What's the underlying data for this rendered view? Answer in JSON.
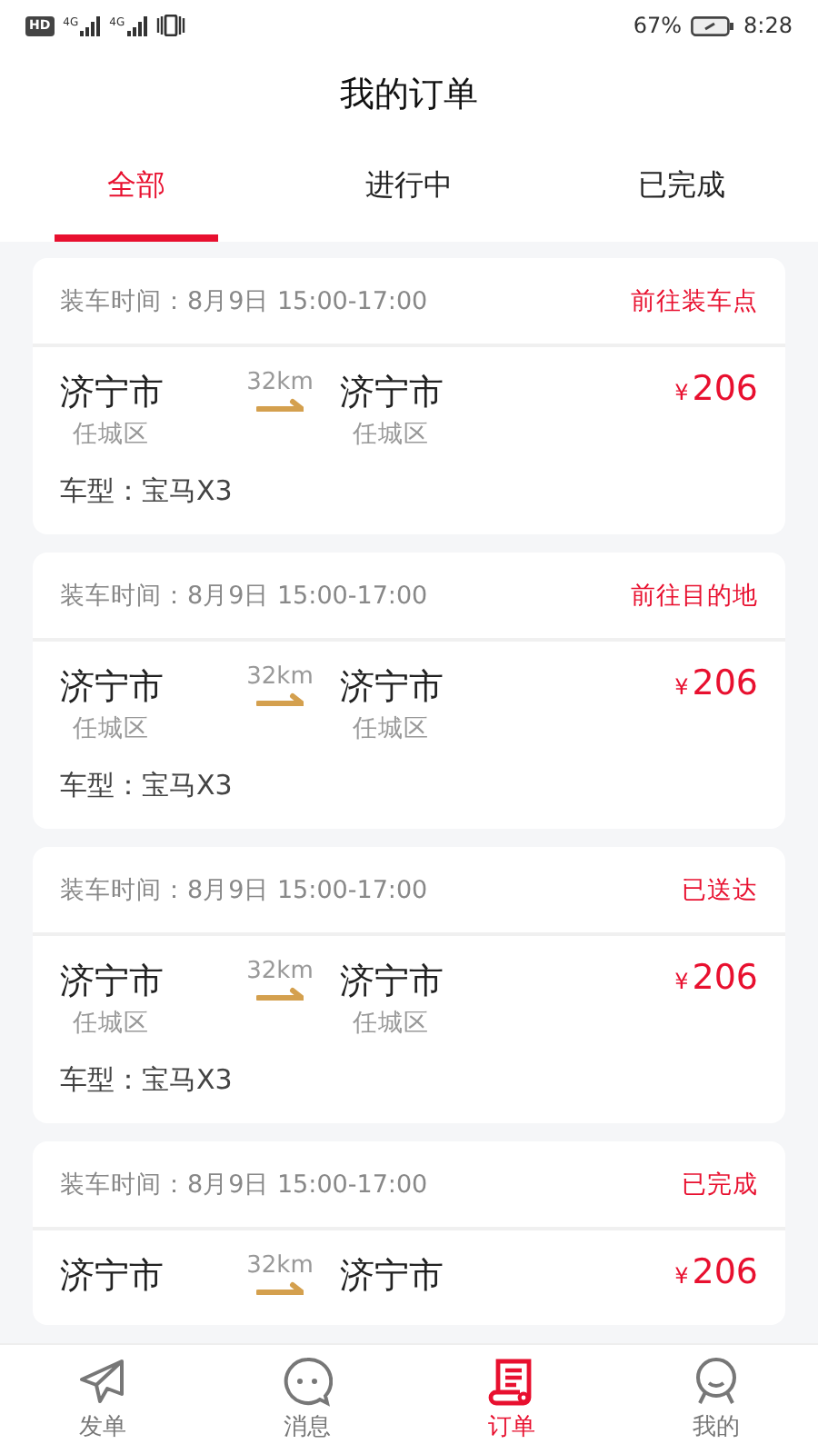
{
  "status_bar": {
    "hd": "HD",
    "networks": [
      "4G",
      "4G"
    ],
    "battery_percent": "67%",
    "time": "8:28"
  },
  "title": "我的订单",
  "tabs": [
    {
      "label": "全部",
      "selected": true
    },
    {
      "label": "进行中",
      "selected": false
    },
    {
      "label": "已完成",
      "selected": false
    }
  ],
  "orders": [
    {
      "load_time": "装车时间：8月9日 15:00-17:00",
      "status": "前往装车点",
      "from_city": "济宁市",
      "from_district": "任城区",
      "distance": "32km",
      "to_city": "济宁市",
      "to_district": "任城区",
      "currency": "¥",
      "price": "206",
      "vehicle": "车型：宝马X3"
    },
    {
      "load_time": "装车时间：8月9日 15:00-17:00",
      "status": "前往目的地",
      "from_city": "济宁市",
      "from_district": "任城区",
      "distance": "32km",
      "to_city": "济宁市",
      "to_district": "任城区",
      "currency": "¥",
      "price": "206",
      "vehicle": "车型：宝马X3"
    },
    {
      "load_time": "装车时间：8月9日 15:00-17:00",
      "status": "已送达",
      "from_city": "济宁市",
      "from_district": "任城区",
      "distance": "32km",
      "to_city": "济宁市",
      "to_district": "任城区",
      "currency": "¥",
      "price": "206",
      "vehicle": "车型：宝马X3"
    },
    {
      "load_time": "装车时间：8月9日 15:00-17:00",
      "status": "已完成",
      "from_city": "济宁市",
      "distance": "32km",
      "to_city": "济宁市",
      "currency": "¥",
      "price": "206"
    }
  ],
  "bottom_nav": [
    {
      "kind": "send",
      "label": "发单",
      "selected": false
    },
    {
      "kind": "message",
      "label": "消息",
      "selected": false
    },
    {
      "kind": "order",
      "label": "订单",
      "selected": true
    },
    {
      "kind": "profile",
      "label": "我的",
      "selected": false
    }
  ]
}
